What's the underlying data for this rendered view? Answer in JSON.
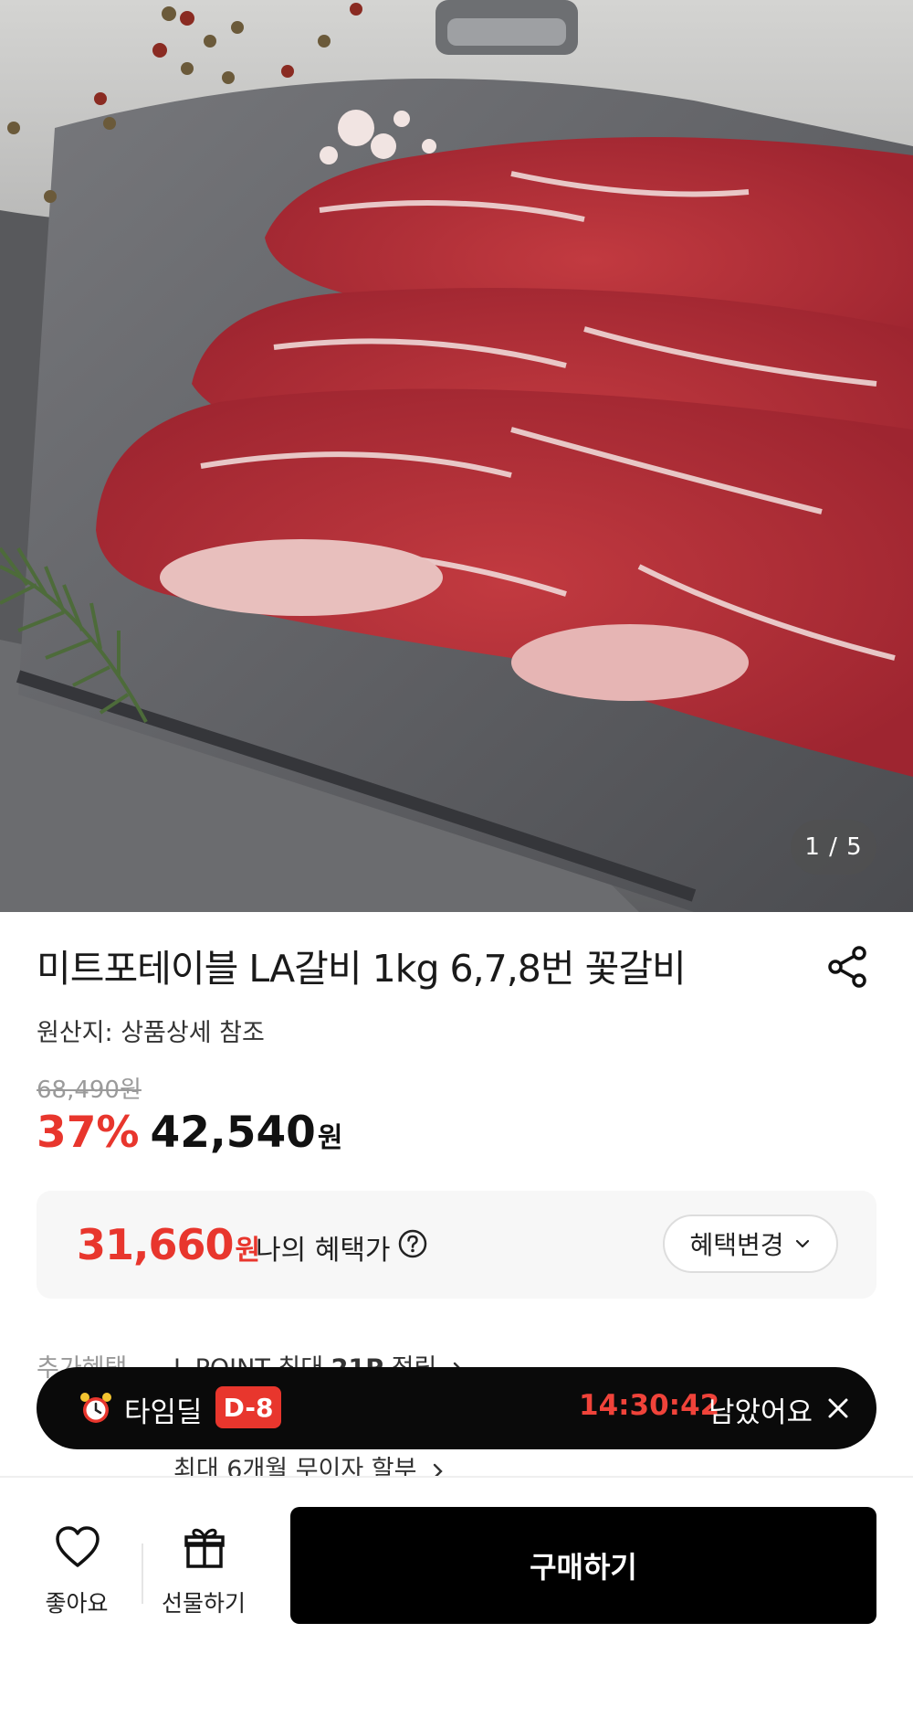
{
  "gallery": {
    "counter": "1 / 5"
  },
  "product": {
    "title": "미트포테이블 LA갈비 1kg 6,7,8번 꽃갈비",
    "origin": "원산지: 상품상세 참조",
    "original_price": "68,490원",
    "discount": "37%",
    "price": "42,540",
    "price_unit": "원"
  },
  "benefit": {
    "price": "31,660",
    "price_unit": "원",
    "label": "나의 혜택가",
    "change_label": "혜택변경"
  },
  "extra_benefits": {
    "label": "추가혜택",
    "point_text_prefix": "L.POINT 최대 ",
    "point_amount": "21P",
    "point_text_suffix": " 적립",
    "installment": "최대 6개월 무이자 할부"
  },
  "time_deal": {
    "label": "타임딜",
    "badge": "D-8",
    "timer": "14:30:42",
    "remain": "남았어요"
  },
  "bottom_bar": {
    "like_label": "좋아요",
    "gift_label": "선물하기",
    "buy_label": "구매하기"
  },
  "colors": {
    "accent": "#e8362d",
    "dark": "#0a0a0a"
  }
}
